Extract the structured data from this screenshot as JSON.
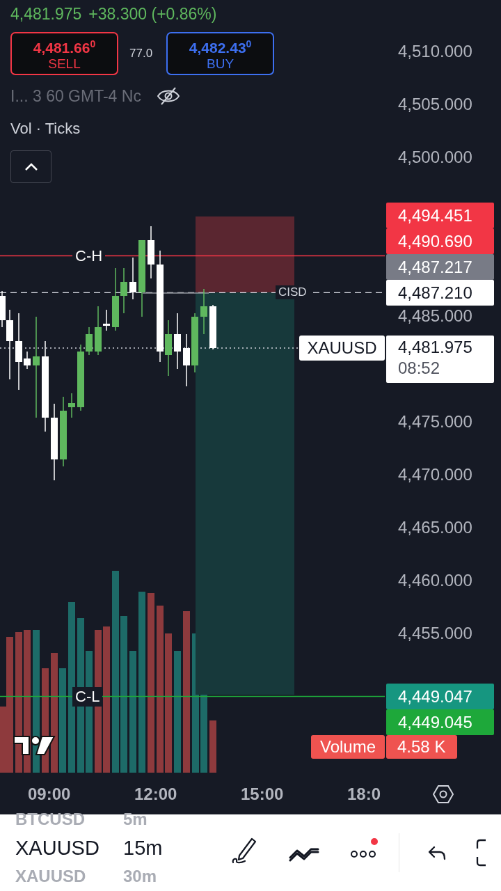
{
  "quote": {
    "price": "4,481.975",
    "change": "+38.300 (+0.86%)"
  },
  "trade": {
    "sell_price": "4,481.66$^{0}$",
    "sell_label": "SELL",
    "spread": "77.0",
    "buy_price": "4,482.43$^{0}$",
    "buy_label": "BUY"
  },
  "legend": {
    "info": "I... 3 60 GMT-4 Nc",
    "indicator": "Vol · Ticks",
    "expanded": false
  },
  "price_axis": [
    "4,510.000",
    "4,505.000",
    "4,500.000",
    "4,485.000",
    "4,475.000",
    "4,470.000",
    "4,465.000",
    "4,460.000",
    "4,455.000"
  ],
  "price_tags": [
    {
      "kind": "tag",
      "price": "4,494.451",
      "color": "#f23645"
    },
    {
      "kind": "tag",
      "price": "4,490.690",
      "color": "#f23645",
      "line_label": "C-H"
    },
    {
      "kind": "tag",
      "price": "4,487.217",
      "color": "#787b86"
    },
    {
      "kind": "tag",
      "price": "4,487.210",
      "color": "#ffffff",
      "line_label": "CISD"
    },
    {
      "kind": "last",
      "symbol": "XAUUSD",
      "price": "4,481.975",
      "countdown": "08:52",
      "color": "#ffffff"
    },
    {
      "kind": "tag",
      "price": "4,449.047",
      "color": "#169680"
    },
    {
      "kind": "tag",
      "price": "4,449.045",
      "color": "#1ea83a",
      "line_label": "C-L"
    }
  ],
  "volume_tag": {
    "label": "Volume",
    "value": "4.58 K",
    "color": "#ef5350"
  },
  "time_axis": [
    "09:00",
    "12:00",
    "15:00",
    "18:0"
  ],
  "toolbar": {
    "symbols": [
      {
        "symbol": "BTCUSD",
        "interval": "5m",
        "selected": false
      },
      {
        "symbol": "XAUUSD",
        "interval": "15m",
        "selected": true
      },
      {
        "symbol": "XAUUSD",
        "interval": "30m",
        "selected": false
      }
    ],
    "more_badge": true
  }
}
